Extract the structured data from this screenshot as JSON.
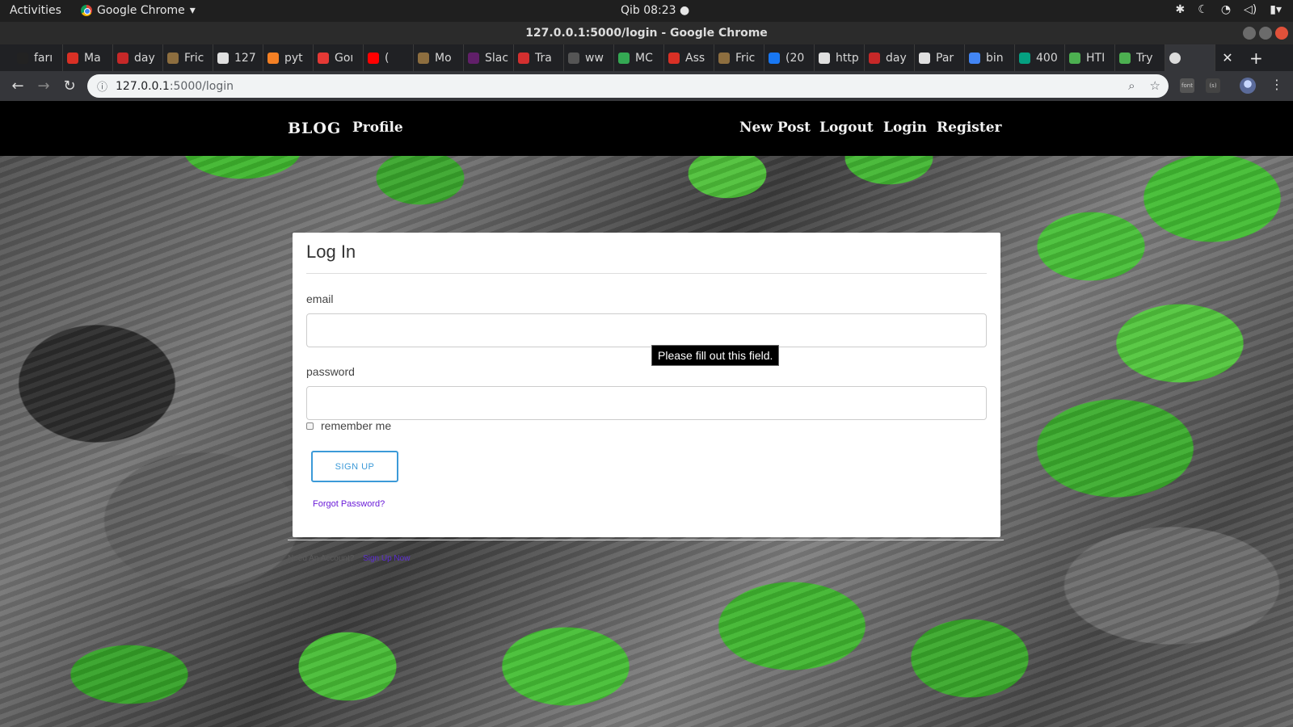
{
  "os": {
    "activities": "Activities",
    "app_name": "Google Chrome",
    "clock": "Qib 08:23 ●"
  },
  "window": {
    "title": "127.0.0.1:5000/login - Google Chrome"
  },
  "tabs": [
    {
      "label": "farı",
      "color": "#222222"
    },
    {
      "label": "Ma",
      "color": "#d93025"
    },
    {
      "label": "day",
      "color": "#c62828"
    },
    {
      "label": "Fric",
      "color": "#8d6e3f"
    },
    {
      "label": "127",
      "color": "#e0e0e0"
    },
    {
      "label": "pyt",
      "color": "#f48024"
    },
    {
      "label": "Goı",
      "color": "#e53935"
    },
    {
      "label": "(",
      "color": "#ff0000"
    },
    {
      "label": "Mo",
      "color": "#8d6e3f"
    },
    {
      "label": "Slac",
      "color": "#611f69"
    },
    {
      "label": "Tra",
      "color": "#d32f2f"
    },
    {
      "label": "ww",
      "color": "#555555"
    },
    {
      "label": "MC",
      "color": "#34a853"
    },
    {
      "label": "Ass",
      "color": "#d93025"
    },
    {
      "label": "Fric",
      "color": "#8d6e3f"
    },
    {
      "label": "(20",
      "color": "#1877f2"
    },
    {
      "label": "http",
      "color": "#e0e0e0"
    },
    {
      "label": "day",
      "color": "#c62828"
    },
    {
      "label": "Par",
      "color": "#e0e0e0"
    },
    {
      "label": "bin",
      "color": "#4285f4"
    },
    {
      "label": "400",
      "color": "#05a081"
    },
    {
      "label": "HTI",
      "color": "#4caf50"
    },
    {
      "label": "Try",
      "color": "#4caf50"
    }
  ],
  "toolbar": {
    "url_host": "127.0.0.1",
    "url_path": ":5000/login",
    "ext1": "font",
    "ext2": "(s)"
  },
  "navbar": {
    "brand": "BLOG",
    "profile": "Profile",
    "new_post": "New Post",
    "logout": "Logout",
    "login": "Login",
    "register": "Register"
  },
  "login_form": {
    "title": "Log In",
    "email_label": "email",
    "password_label": "password",
    "remember_label": "remember me",
    "submit_label": "Sign Up",
    "forgot_link": "Forgot Password?",
    "validation_tooltip": "Please fill out this field."
  },
  "footer": {
    "need_account": "Need An Account?",
    "sign_up_now": "Sign Up Now"
  }
}
